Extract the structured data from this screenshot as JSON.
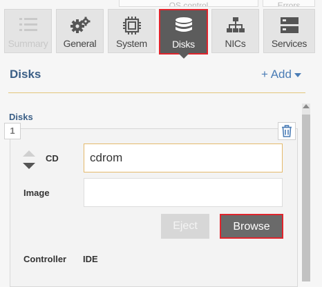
{
  "top_tabs": [
    {
      "label": "OS control"
    },
    {
      "label": "Errors"
    }
  ],
  "tabs": [
    {
      "label": "Summary",
      "icon": "checklist-icon",
      "state": "disabled"
    },
    {
      "label": "General",
      "icon": "gears-icon",
      "state": "normal"
    },
    {
      "label": "System",
      "icon": "cpu-chip-icon",
      "state": "normal"
    },
    {
      "label": "Disks",
      "icon": "disk-stack-icon",
      "state": "active"
    },
    {
      "label": "NICs",
      "icon": "network-icon",
      "state": "normal"
    },
    {
      "label": "Services",
      "icon": "server-icon",
      "state": "normal"
    }
  ],
  "section": {
    "title": "Disks",
    "add_label": "+ Add",
    "subtitle": "Disks"
  },
  "disk": {
    "index": "1",
    "type_label": "CD",
    "type_value": "cdrom",
    "image_label": "Image",
    "image_value": "",
    "eject_label": "Eject",
    "browse_label": "Browse",
    "controller_label": "Controller",
    "controller_value": "IDE"
  },
  "colors": {
    "accent_blue": "#3b5f86",
    "highlight_red": "#e0242c",
    "active_tab_bg": "#5c5c5c"
  }
}
